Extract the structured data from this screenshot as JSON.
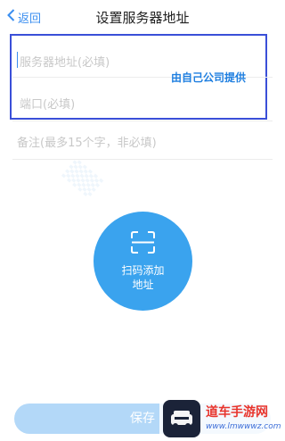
{
  "nav": {
    "back_label": "返回",
    "title": "设置服务器地址"
  },
  "form": {
    "server_placeholder": "服务器地址(必填)",
    "port_placeholder": "端口(必填)",
    "note_placeholder": "备注(最多15个字，非必填)"
  },
  "annotation": "由自己公司提供",
  "scan": {
    "label": "扫码添加\n地址"
  },
  "save_label": "保存",
  "brand": {
    "name": "道车手游网",
    "url": "www.lmwwwz.com"
  },
  "colors": {
    "accent": "#3a8ef0",
    "scan_button": "#3aa3ee",
    "save_button": "#b3d8f8",
    "highlight_border": "#3a4fd8"
  },
  "icons": [
    "back-chevron-icon",
    "scan-icon"
  ]
}
